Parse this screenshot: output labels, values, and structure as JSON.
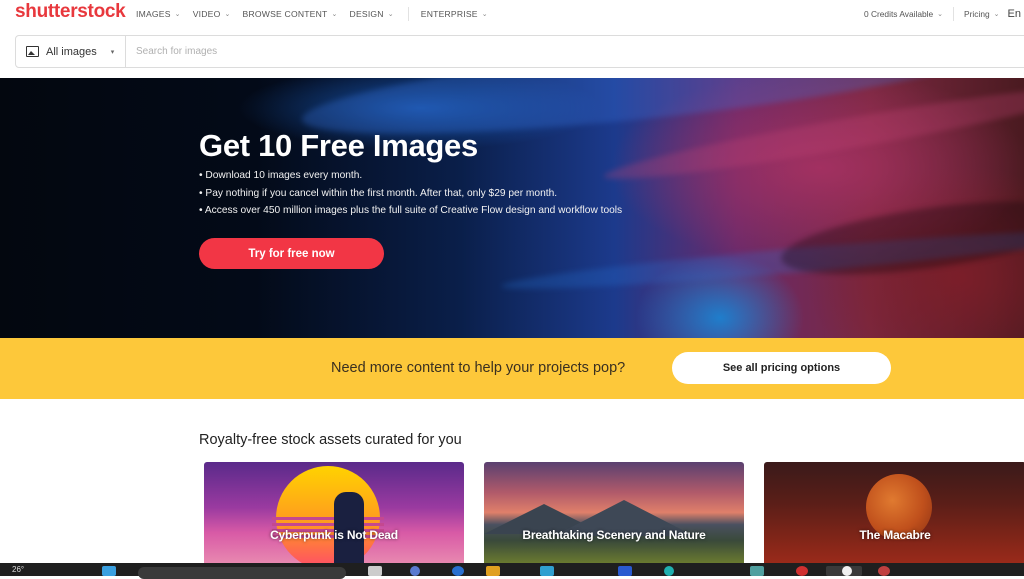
{
  "header": {
    "logo": "shutterstock",
    "nav": [
      {
        "label": "IMAGES"
      },
      {
        "label": "VIDEO"
      },
      {
        "label": "BROWSE CONTENT"
      },
      {
        "label": "DESIGN"
      },
      {
        "label": "ENTERPRISE"
      }
    ],
    "credits": "0 Credits Available",
    "pricing": "Pricing",
    "language": "En",
    "chevron": "⌄"
  },
  "search": {
    "scope": "All images",
    "caret": "▾",
    "placeholder": "Search for images",
    "value": ""
  },
  "hero": {
    "title": "Get 10 Free Images",
    "bullets": [
      "• Download 10 images every month.",
      "• Pay nothing if you cancel within the first month. After that, only $29 per month.",
      "• Access over 450 million images plus the full suite of Creative Flow design and workflow tools"
    ],
    "cta": "Try for free now",
    "cta_color": "#f23645"
  },
  "promo": {
    "text": "Need more content to help your projects pop?",
    "button": "See all pricing options",
    "bg_color": "#fdc83a"
  },
  "curated": {
    "title": "Royalty-free stock assets curated for you",
    "cards": [
      {
        "label": "Cyberpunk is Not Dead"
      },
      {
        "label": "Breathtaking Scenery and Nature"
      },
      {
        "label": "The Macabre"
      }
    ]
  },
  "taskbar": {
    "weather": "26°"
  },
  "colors": {
    "brand": "#e8383d"
  }
}
